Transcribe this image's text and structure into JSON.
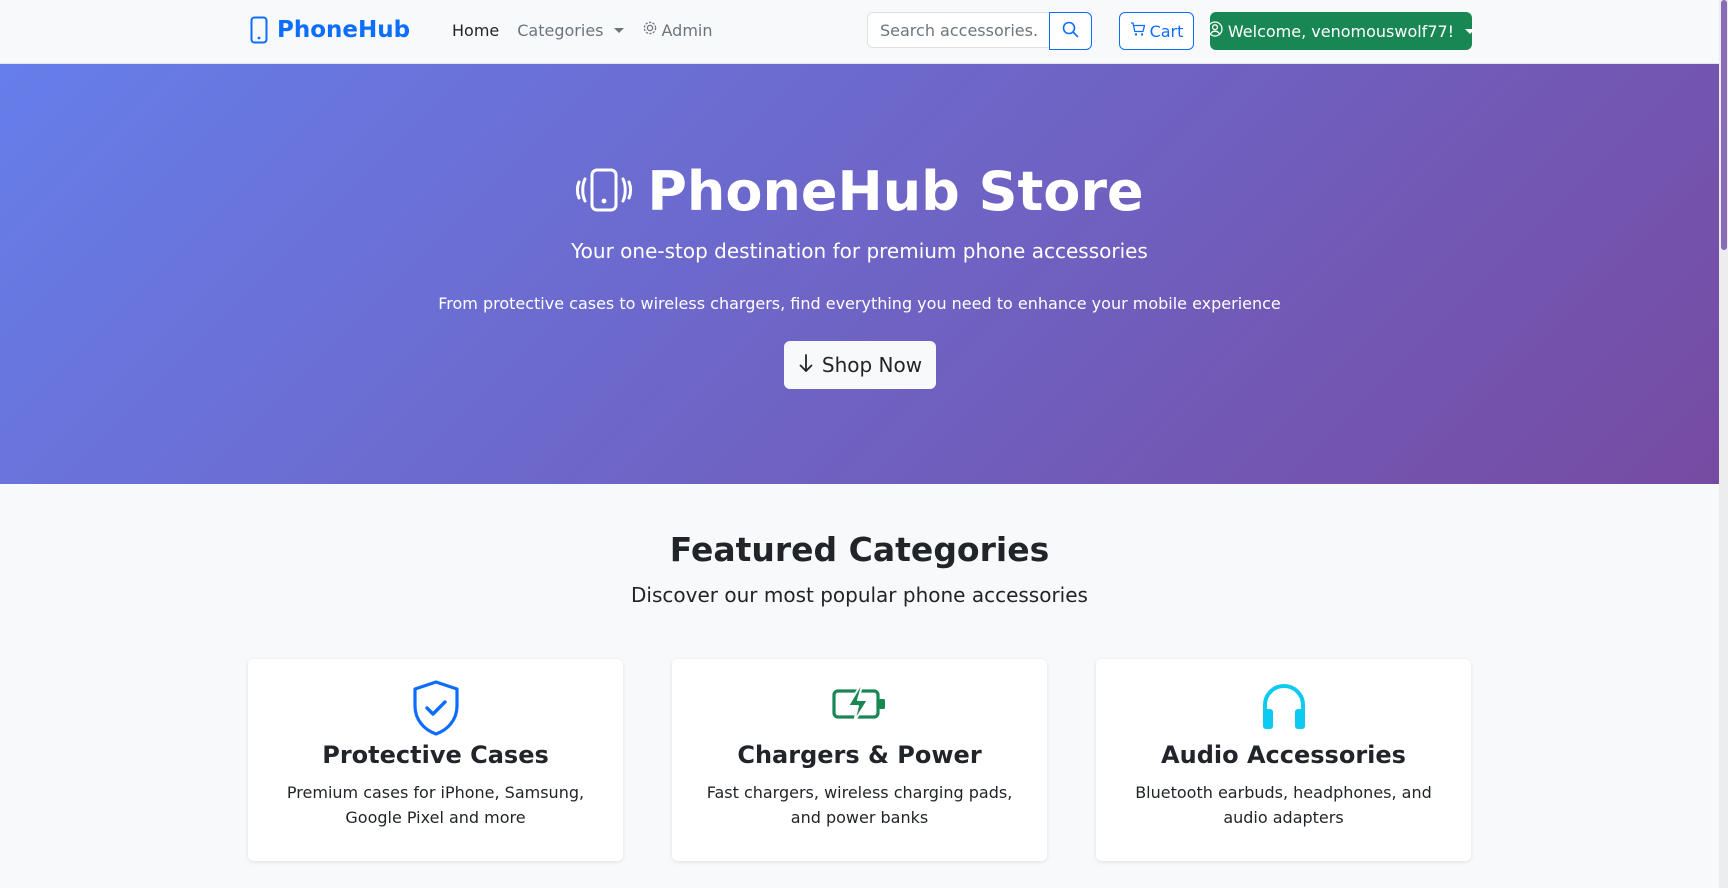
{
  "brand": {
    "name": "PhoneHub",
    "icon": "phone-icon",
    "color": "#0d6efd"
  },
  "nav": {
    "home": "Home",
    "categories": "Categories",
    "admin": "Admin"
  },
  "search": {
    "placeholder": "Search accessories..."
  },
  "cart": {
    "label": "Cart"
  },
  "user": {
    "label": "Welcome, venomouswolf77!",
    "color": "#198754"
  },
  "hero": {
    "title": "PhoneHub Store",
    "subtitle": "Your one-stop destination for premium phone accessories",
    "description": "From protective cases to wireless chargers, find everything you need to enhance your mobile experience",
    "button": "Shop Now",
    "gradient": [
      "#667eea",
      "#764ba2"
    ]
  },
  "featured": {
    "title": "Featured Categories",
    "subtitle": "Discover our most popular phone accessories",
    "cards": [
      {
        "title": "Protective Cases",
        "description": "Premium cases for iPhone, Samsung, Google Pixel and more",
        "icon": "shield-check-icon",
        "color": "#0d6efd"
      },
      {
        "title": "Chargers & Power",
        "description": "Fast chargers, wireless charging pads, and power banks",
        "icon": "battery-charging-icon",
        "color": "#198754"
      },
      {
        "title": "Audio Accessories",
        "description": "Bluetooth earbuds, headphones, and audio adapters",
        "icon": "headphones-icon",
        "color": "#0dcaf0"
      }
    ]
  }
}
